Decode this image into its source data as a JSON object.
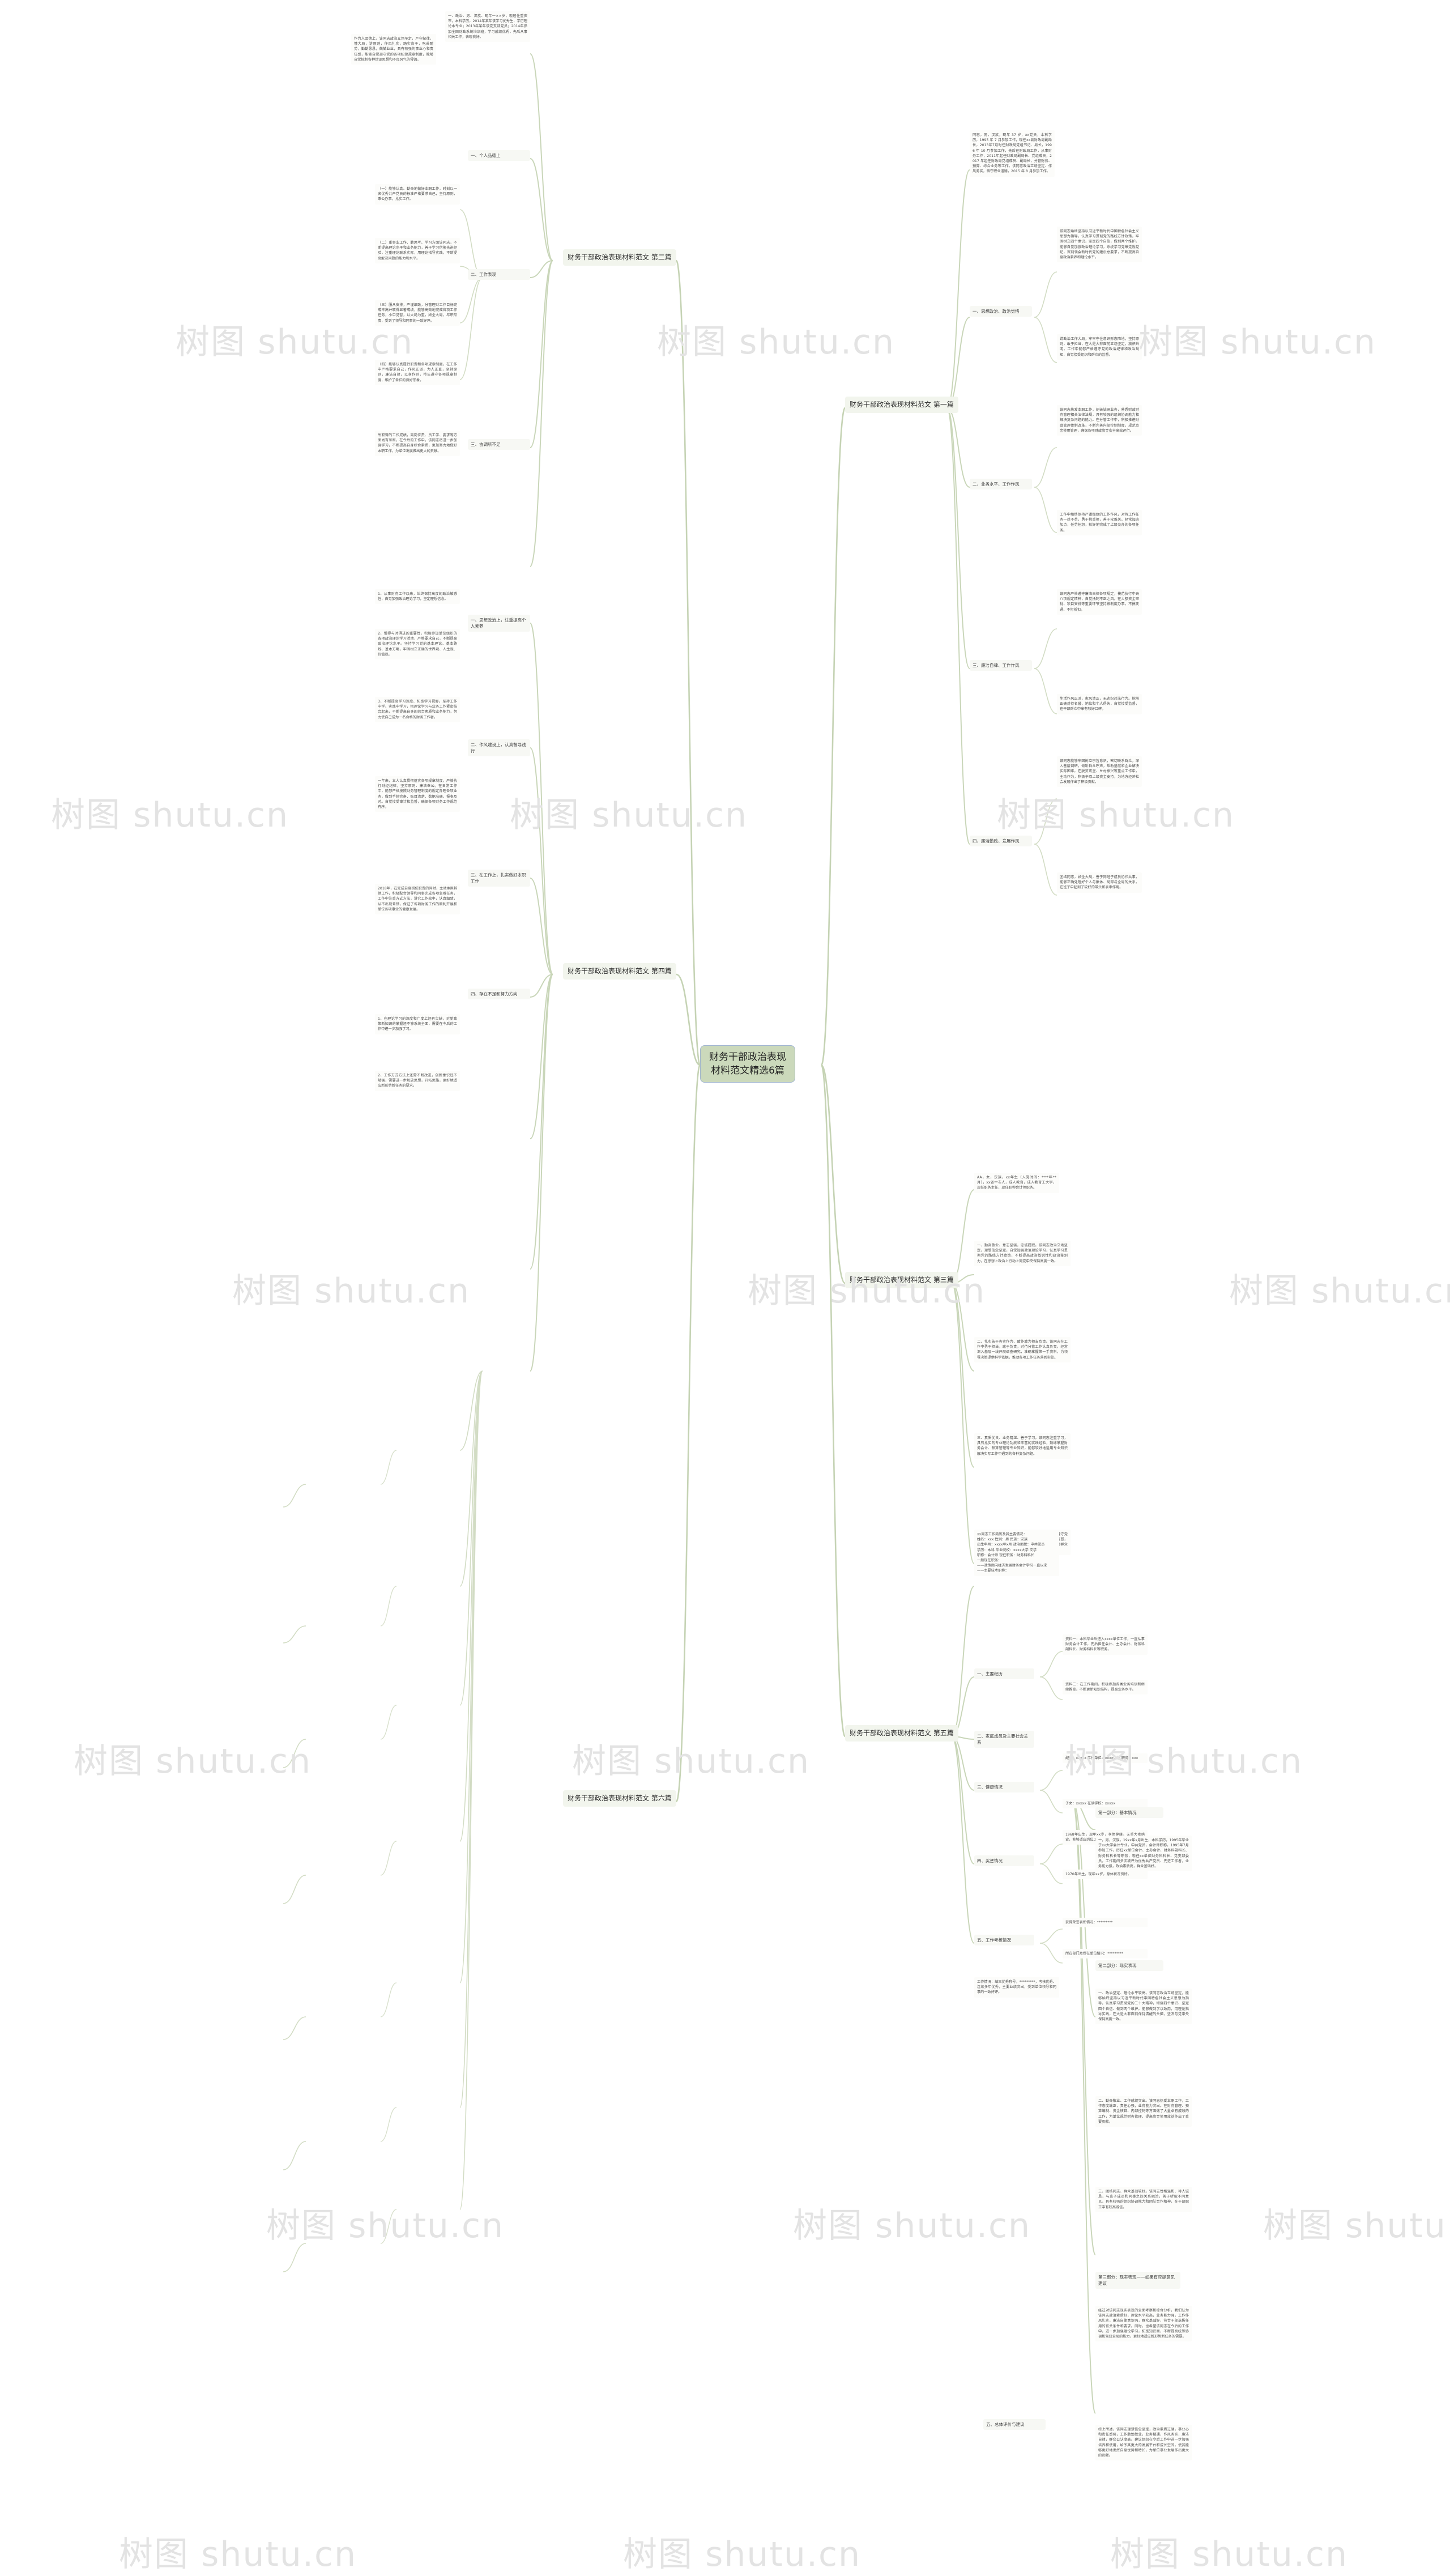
{
  "site": {
    "watermark": "树图 shutu.cn"
  },
  "root": {
    "title": "财务干部政治表现材料范文精选6篇"
  },
  "branches": [
    {
      "id": "b1",
      "label": "财务干部政治表现材料范文 第一篇"
    },
    {
      "id": "b2",
      "label": "财务干部政治表现材料范文 第二篇"
    },
    {
      "id": "b3",
      "label": "财务干部政治表现材料范文 第三篇"
    },
    {
      "id": "b4",
      "label": "财务干部政治表现材料范文 第四篇"
    },
    {
      "id": "b5",
      "label": "财务干部政治表现材料范文 第五篇"
    },
    {
      "id": "b6",
      "label": "财务干部政治表现材料范文 第六篇"
    }
  ],
  "b1": {
    "intro": "同志，男，汉族，现年 37 岁，xx党员，本科学历，1995 年 7 月参加工作，现任xx县财政局副局长，2013年7月时任财政局党组书记、局长，1996 年 10 月参加工作，先后在财政局工作，从事财务工作，2011年起任财政局副局长、党组成员，2017 年起任财政局党组成员、副局长，分管财务、预算、综合业务等工作。该同志政治立场坚定、作风务实，恪守职业道德，2015 年 8 月参加工作。",
    "topics": [
      {
        "title": "一、思想政治、政治觉悟",
        "items": [
          "该同志始终坚持以习近平新时代中国特色社会主义思想为指导，认真学习贯彻党的路线方针政策，牢固树立四个意识，坚定四个自信，做到两个维护。能够自觉加强政治理论学习，系统学习党章党规党纪，深刻领会新时代党的建设总要求，不断提高自身政治素养和理论水平。",
          "讲政治工作大局，牢牢守住意识形态阵地，坚持原则，敢于担当，在大是大非面前立场坚定，旗帜鲜明。工作中能够严格遵守党的政治纪律和政治规矩，自觉接受组织和群众的监督。"
        ]
      },
      {
        "title": "二、业务水平、工作作风",
        "items": [
          "该同志热爱本职工作，刻苦钻研业务，熟悉财政财务管理相关法律法规，具有较强的组织协调能力和解决复杂问题的能力。在分管工作中，积极推进财政管理体制改革，不断完善内部控制制度，规范资金使用管理，确保各项财政资金安全高效运行。",
          "工作中始终保持严谨细致的工作作风，对待工作任务一丝不苟，勇于挑重担，善于攻难关。经常加班加点，任劳任怨，较好地完成了上级交办的各项任务。"
        ]
      },
      {
        "title": "三、廉洁自律、工作作风",
        "items": [
          "该同志严格遵守廉洁自律各项规定，模范执行中央八项规定精神，自觉抵制不正之风。在大额资金审批、项目安排等重要环节坚持按制度办事，不搞变通、不打折扣。",
          "生活作风正派，家风清正，无违纪违法行为。能够正确对待名誉、地位和个人得失，自觉接受监督，在干部群众中享有较好口碑。"
        ]
      },
      {
        "title": "四、廉洁勤政、发展作风",
        "items": [
          "该同志能够牢固树立宗旨意识，密切联系群众，深入基层调研，倾听群众呼声，帮助基层和企业解决实际困难。在脱贫攻坚、乡村振兴等重点工作中，主动作为，积极争取上级资金支持，为地方经济社会发展作出了积极贡献。",
          "团结同志，顾全大局，善于同班子成员协作共事，能够正确处理好个人与集体、局部与全局的关系，在班子中起到了较好的带头和表率作用。"
        ]
      }
    ]
  },
  "b2": {
    "items": [
      "一、政治、男、汉族、现年一××岁，现居住重庆市，本科学历，2014年某年该学习优秀生，学历理论本专业；2013年某年该党支部党员；2014年参加全国财政系统培训班，学习成绩优秀，先后从事相关工作，表现良好。"
    ],
    "topics": [
      {
        "title": "一、个人品德上",
        "items": [
          "作为人品德上，该同志政治立场坚定，严守纪律，懂大局，讲原则，作风扎实，踏实肯干，吃苦耐劳，勤勤恳恳，兢兢业业，具有较强的事业心和责任感，能够自觉遵守党的各项纪律规章制度，能够自觉抵制各种错误思想和不良风气的侵蚀。"
        ]
      },
      {
        "title": "二、工作表现",
        "items": [
          "（一）能够认真、勤奋地做好本职工作，时刻以一名优秀共产党员的标准严格要求自己，坚持原则，秉公办事，扎实工作。",
          "（二）重事业工作、勤思考、学习方面该同志，不断提高理论水平和业务能力，善于学习借鉴先进经验，注重理论联系实际，用理论指导实践，不断提高解决问题的能力和水平。",
          "（三）服从安排，严谨细致，分管理财工作目标完成率高并取得显著成绩，能够高效地完成各项工作任务，小中见智，以大局为重，顾全大局，尽职尽责，受到了领导和同事的一致好评。",
          "（四）能够认真履行职责和各项规章制度，在工作中严格要求自己，作风正派，为人正直，坚持原则，廉洁自律，以身作则，带头遵守各项规章制度，维护了单位的良好形象。"
        ]
      },
      {
        "title": "三、协调所不足",
        "items": [
          "所取得的工作成绩，离岗位责、员工学、要求等方面尚有差距，在今后的工作中，该同志将进一步加强学习，不断提高自身综合素质，更加努力地做好本职工作，为单位发展做出更大的贡献。"
        ]
      }
    ]
  },
  "b3": {
    "intro": "AA，女，汉族，xx年生（入党时间：****年**月），xx省**市人，成人教育，成人教育工大学，现任职务主任，现任职称会计师职务。",
    "topics": [
      {
        "title": "一、勤奋敬业、意志坚强，忠诚履职。该同志政治立场坚定，理想信念坚定，自觉加强政治理论学习，认真学习贯彻党的路线方针政策，不断提高政治敏锐性和政治鉴别力，在思想上政治上行动上同党中央保持高度一致。",
        "items": []
      },
      {
        "title": "二、扎实苦干务实作为、敢作敢为担当负责。该同志在工作中勇于担当，敢于负责，对待分管工作认真负责，经常深入基层一线开展调查研究，准确掌握第一手资料，为领导决策提供科学依据，推动各项工作任务落到实处。",
        "items": []
      },
      {
        "title": "三、素质优良、业务精湛、善于学习。该同志注重学习，具有扎实的专业理论功底和丰富的实践经验，熟练掌握财务会计、预算管理等专业知识，能够较好地运用专业知识解决实际工作中遇到的各种复杂问题。",
        "items": []
      },
      {
        "title": "四、严于律己、廉洁自律、作风正派。该同志严格遵守党纪国法和廉洁从政各项规定，自觉接受组织和群众监督，生活俭朴，作风正派，团结同志，谦虚谨慎，在干部群众中有较高的威信和良好的口碑。",
        "items": []
      }
    ]
  },
  "b4": {
    "sections": [
      {
        "title": "一、思想政治上，注重提高个人素养",
        "items": [
          "1、从事财务工作以来，始终保持高度的政治敏感性，自觉加强政治理论学习，坚定理想信念。",
          "2、懂得与时俱进的重要性，积极参加单位组织的各项政治理论学习活动，严格要求自己，不断提高政治理论水平。坚持学习党的基本理论、基本路线、基本方略，牢固树立正确的世界观、人生观、价值观。",
          "3、不断提高学习深度、拓宽学习视野。坚持工作中学、实践中学习，把理论学习与业务工作紧密结合起来，不断提高自身的综合素质和业务能力，努力使自己成为一名合格的财务工作者。"
        ]
      },
      {
        "title": "二、作风建设上，认真督导践行",
        "items": [
          "一年来，本人认真贯彻落实各项规章制度，严格执行财经纪律，坚持原则、廉洁奉公。在日常工作中，能够严格按照财务管理制度的规定办理各项业务，做到手续完备、账目清楚、数据准确、报表及时。自觉接受审计和监督，确保各项财务工作规范有序。"
        ]
      },
      {
        "title": "三、在工作上，扎实做好本职工作",
        "items": [
          "2018年，在完成自身岗位职责的同时，主动承担其他工作，积极配合领导和同事完成各项急难任务，工作中注重方式方法，讲究工作效率，认真细致，从不出现差错，保证了各项财务工作的顺利开展和单位各项事业的健康发展。"
        ]
      },
      {
        "title": "四、存在不足和努力方向",
        "items": [
          "1、在理论学习的深度和广度上还有欠缺，对新政策新知识的掌握还不够系统全面，需要在今后的工作中进一步加强学习。",
          "2、工作方式方法上还需不断改进，创新意识还不够强，需要进一步解放思想，开拓思路，更好地适应新形势新任务的要求。"
        ]
      }
    ]
  },
  "b5": {
    "intro": "xx同志工作简历及其主要情况：\n姓名：xxx 性别：男 民族：汉族\n出生年月：xxxx年x月 政治面貌：中共党员\n学历：本科 毕业院校：xxxx大学 文学\n职称：会计师 现任职务：财务科科长\n一般现任职务：\n——政策面向经济发展财务会计学习一直以来\n——主要技术职称：",
    "topics": [
      {
        "title": "一、主要经历",
        "items": [
          "资料一：本科毕业后进入xxxx单位工作，一直从事财务会计工作，先后担任会计、主办会计、财务科副科长、财务科科长等职务。",
          "资料二：在工作期间，积极参加各类业务培训和继续教育，不断更新知识结构，提高业务水平。"
        ]
      },
      {
        "title": "二、家庭成员及主要社会关系",
        "items": [
          "配偶：xxxxx 工作单位：xxxx单位 职务：xxx",
          "子女：xxxxx 在读学校：xxxxx"
        ]
      },
      {
        "title": "三、健康情况",
        "items": [
          "1968年出生，现年xx岁，身体健康，无重大疾病史，能够适应岗位工作需要。",
          "1970年出生，现年xx岁，身体状况良好。"
        ]
      },
      {
        "title": "四、奖惩情况",
        "items": [
          "获得荣誉表彰情况：*********",
          "所在部门及所在单位情况：*********"
        ]
      },
      {
        "title": "五、工作考核情况",
        "items": [
          "工作情况：结果优秀称号，*********，考核优秀、连续多年优秀，主要业绩突出，受到单位领导和同事的一致好评。"
        ]
      }
    ]
  },
  "b6": {
    "sections": [
      {
        "title": "第一部分：基本情况",
        "items": [
          "**，男，汉族，19xx年x月出生，本科学历，1995年毕业于xx大学会计专业，中共党员，会计师职称。1995年7月参加工作，历任xx单位会计、主办会计、财务科副科长、财务科科长等职务，现任xx单位财务科科长、党支部委员。工作期间多次被评为优秀共产党员、先进工作者，业务能力强，政治素质高，群众基础好。"
        ]
      },
      {
        "title": "第二部分：现实表现",
        "items": [
          "一、政治坚定、理论水平较高。该同志政治立场坚定，能够始终坚持以习近平新时代中国特色社会主义思想为指导，认真学习贯彻党的二十大精神，增强四个意识、坚定四个自信、做到两个维护。能够做到学以致用，用理论指导实践，在大是大非面前保持清醒的头脑，坚决与党中央保持高度一致。",
          "二、勤奋敬业、工作成绩突出。该同志热爱本职工作，工作态度端正，责任心强，业务能力突出。在财务管理、预算编制、资金核算、内部控制等方面做了大量卓有成效的工作，为单位规范财务管理、提高资金使用效益作出了重要贡献。",
          "三、团结同志、群众基础较好。该同志性格温和、待人诚恳，与班子成员和同事之间关系融洽，善于听取不同意见，具有较强的组织协调能力和团队合作精神，在干部职工中有较高威信。"
        ]
      },
      {
        "title": "第三部分：现实表现——如果有应提意见建议",
        "items": [
          "经过对该同志现实表现的全面考察和综合分析，我们认为该同志政治素质好，理论水平较高，业务能力强，工作作风扎实，廉洁自律意识强，群众基础好，符合干部选拔任用的有关条件和要求。同时，也希望该同志在今后的工作中，进一步加强理论学习，拓宽知识面，不断提高统筹协调和驾驭全局的能力，更好地适应新形势新任务的需要。"
        ]
      },
      {
        "title": "五、总体评价与建议",
        "items": [
          "综上所述，该同志理想信念坚定，政治素质过硬，事业心和责任感强，工作勤勉敬业，业务精通，作风务实，廉洁自律，群众公认度高。建议组织在今后工作中进一步加强培养和使用，给予其更大的发展平台和成长空间，使其能够更好地发挥自身优势和特长，为单位事业发展作出更大的贡献。"
        ]
      }
    ]
  }
}
